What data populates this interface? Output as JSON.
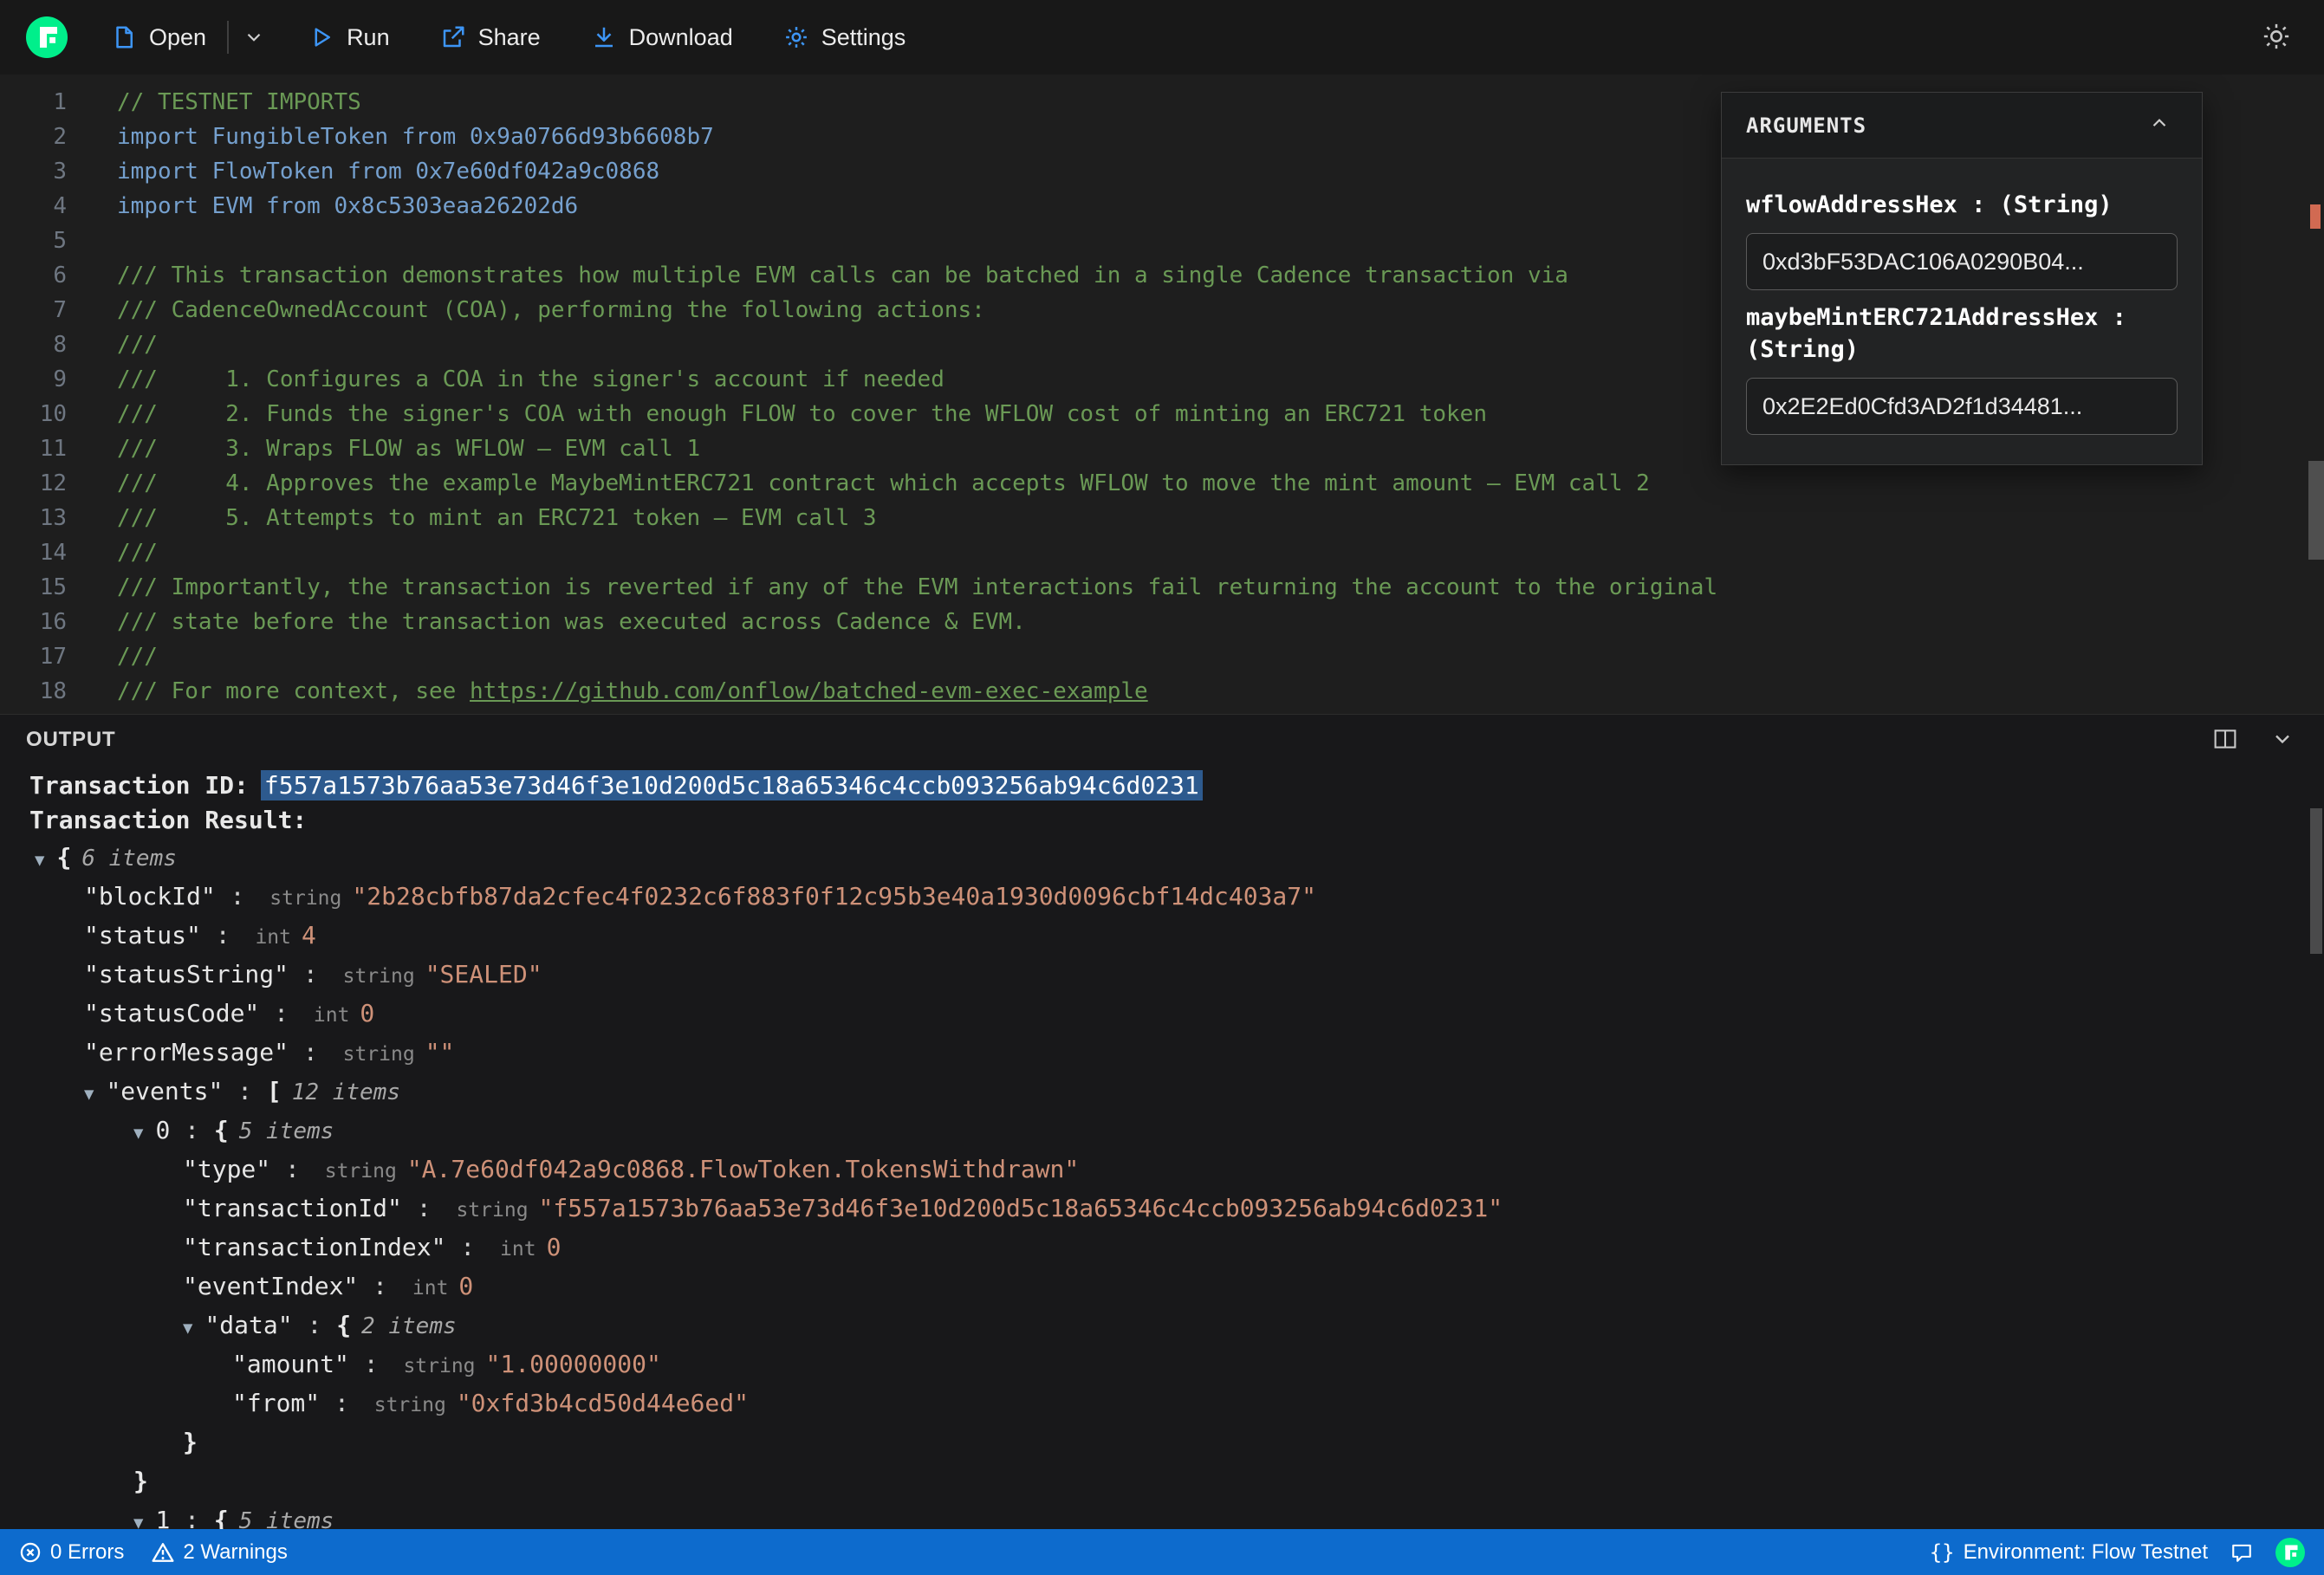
{
  "theme": {
    "flow_green": "#00EF8B",
    "toolbar_icon_blue": "#3D95F5",
    "statusbar_blue": "#0D6BCD",
    "selection_blue": "#2D5A8E",
    "comment_green": "#6A9955",
    "code_blue": "#75A0CE",
    "string_orange": "#CE9178",
    "error_mark_red": "#D16A52"
  },
  "icons": {
    "flow-logo": "flow mark in green circle",
    "file-icon": "document",
    "chevron-down-icon": "v",
    "play-icon": "outlined triangle",
    "share-icon": "arrow out of box",
    "download-icon": "arrow down to line",
    "gear-icon": "gear",
    "sun-icon": "sun",
    "split-editor-icon": "split rectangle",
    "collapse-chevron-icon": "^",
    "error-icon": "circle with x",
    "warning-icon": "triangle with !",
    "feedback-icon": "speech bubble",
    "braces-icon": "{}"
  },
  "toolbar": {
    "open_label": "Open",
    "run_label": "Run",
    "share_label": "Share",
    "download_label": "Download",
    "settings_label": "Settings"
  },
  "editor": {
    "lines": [
      {
        "num": "1",
        "type": "comment",
        "text": "// TESTNET IMPORTS"
      },
      {
        "num": "2",
        "type": "code",
        "text": "import FungibleToken from 0x9a0766d93b6608b7"
      },
      {
        "num": "3",
        "type": "code",
        "text": "import FlowToken from 0x7e60df042a9c0868"
      },
      {
        "num": "4",
        "type": "code",
        "text": "import EVM from 0x8c5303eaa26202d6"
      },
      {
        "num": "5",
        "type": "code",
        "text": ""
      },
      {
        "num": "6",
        "type": "comment",
        "text": "/// This transaction demonstrates how multiple EVM calls can be batched in a single Cadence transaction via"
      },
      {
        "num": "7",
        "type": "comment",
        "text": "/// CadenceOwnedAccount (COA), performing the following actions:"
      },
      {
        "num": "8",
        "type": "comment",
        "text": "///"
      },
      {
        "num": "9",
        "type": "comment",
        "text": "///     1. Configures a COA in the signer's account if needed"
      },
      {
        "num": "10",
        "type": "comment",
        "text": "///     2. Funds the signer's COA with enough FLOW to cover the WFLOW cost of minting an ERC721 token"
      },
      {
        "num": "11",
        "type": "comment",
        "text": "///     3. Wraps FLOW as WFLOW — EVM call 1"
      },
      {
        "num": "12",
        "type": "comment",
        "text": "///     4. Approves the example MaybeMintERC721 contract which accepts WFLOW to move the mint amount — EVM call 2"
      },
      {
        "num": "13",
        "type": "comment",
        "text": "///     5. Attempts to mint an ERC721 token — EVM call 3"
      },
      {
        "num": "14",
        "type": "comment",
        "text": "///"
      },
      {
        "num": "15",
        "type": "comment",
        "text": "/// Importantly, the transaction is reverted if any of the EVM interactions fail returning the account to the original"
      },
      {
        "num": "16",
        "type": "comment",
        "text": "/// state before the transaction was executed across Cadence & EVM."
      },
      {
        "num": "17",
        "type": "comment",
        "text": "///"
      },
      {
        "num": "18",
        "type": "comment",
        "text": "/// For more context, see ",
        "link": "https://github.com/onflow/batched-evm-exec-example"
      }
    ]
  },
  "arguments_panel": {
    "title": "ARGUMENTS",
    "fields": [
      {
        "label": "wflowAddressHex : (String)",
        "value": "0xd3bF53DAC106A0290B04..."
      },
      {
        "label": "maybeMintERC721AddressHex : (String)",
        "value": "0x2E2Ed0Cfd3AD2f1d34481..."
      }
    ]
  },
  "output": {
    "title": "OUTPUT",
    "transaction_id_label": "Transaction ID:",
    "transaction_id": "f557a1573b76aa53e73d46f3e10d200d5c18a65346c4ccb093256ab94c6d0231",
    "transaction_result_label": "Transaction Result:",
    "tree": [
      {
        "depth": 0,
        "toggle": true,
        "punct": "{",
        "meta": "6 items"
      },
      {
        "depth": 1,
        "key": "\"blockId\"",
        "type": "string",
        "value": "\"2b28cbfb87da2cfec4f0232c6f883f0f12c95b3e40a1930d0096cbf14dc403a7\""
      },
      {
        "depth": 1,
        "key": "\"status\"",
        "type": "int",
        "value": "4"
      },
      {
        "depth": 1,
        "key": "\"statusString\"",
        "type": "string",
        "value": "\"SEALED\""
      },
      {
        "depth": 1,
        "key": "\"statusCode\"",
        "type": "int",
        "value": "0"
      },
      {
        "depth": 1,
        "key": "\"errorMessage\"",
        "type": "string",
        "value": "\"\""
      },
      {
        "depth": 1,
        "toggle": true,
        "key": "\"events\"",
        "punct": "[",
        "meta": "12 items"
      },
      {
        "depth": 2,
        "toggle": true,
        "key": "0",
        "punct": "{",
        "meta": "5 items"
      },
      {
        "depth": 3,
        "key": "\"type\"",
        "type": "string",
        "value": "\"A.7e60df042a9c0868.FlowToken.TokensWithdrawn\""
      },
      {
        "depth": 3,
        "key": "\"transactionId\"",
        "type": "string",
        "value": "\"f557a1573b76aa53e73d46f3e10d200d5c18a65346c4ccb093256ab94c6d0231\""
      },
      {
        "depth": 3,
        "key": "\"transactionIndex\"",
        "type": "int",
        "value": "0"
      },
      {
        "depth": 3,
        "key": "\"eventIndex\"",
        "type": "int",
        "value": "0"
      },
      {
        "depth": 3,
        "toggle": true,
        "key": "\"data\"",
        "punct": "{",
        "meta": "2 items"
      },
      {
        "depth": 4,
        "key": "\"amount\"",
        "type": "string",
        "value": "\"1.00000000\""
      },
      {
        "depth": 4,
        "key": "\"from\"",
        "type": "string",
        "value": "\"0xfd3b4cd50d44e6ed\""
      },
      {
        "depth": 3,
        "punct": "}"
      },
      {
        "depth": 2,
        "punct": "}"
      },
      {
        "depth": 2,
        "toggle": true,
        "key": "1",
        "punct": "{",
        "meta": "5 items"
      }
    ]
  },
  "statusbar": {
    "errors_label": "0 Errors",
    "warnings_label": "2 Warnings",
    "environment_icon": "{}",
    "environment_label": "Environment: Flow Testnet"
  }
}
